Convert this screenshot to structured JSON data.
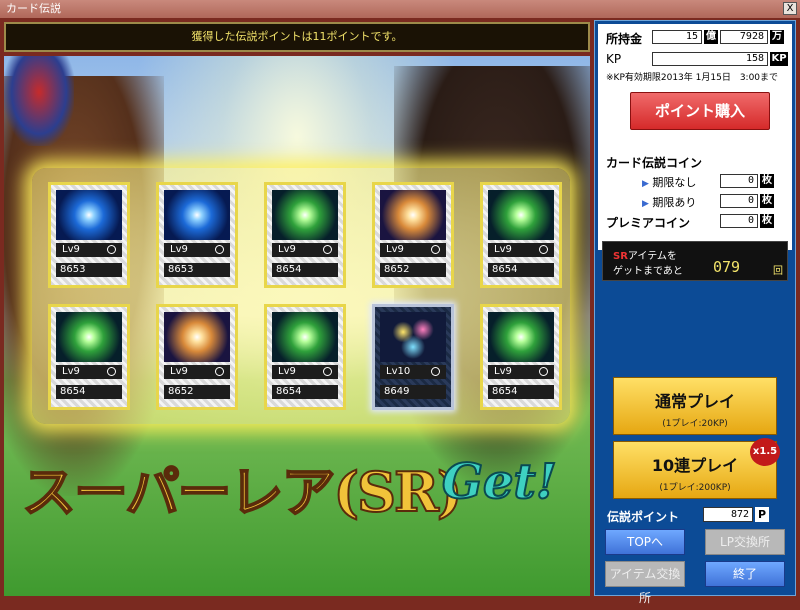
{
  "window": {
    "title": "カード伝説",
    "close_label": "X"
  },
  "message": "獲得した伝説ポイントは11ポイントです。",
  "cards": [
    {
      "level": "Lv9",
      "mark": "○",
      "number": "8653",
      "art": "blue"
    },
    {
      "level": "Lv9",
      "mark": "○",
      "number": "8653",
      "art": "blue"
    },
    {
      "level": "Lv9",
      "mark": "○",
      "number": "8654",
      "art": "green"
    },
    {
      "level": "Lv9",
      "mark": "○",
      "number": "8652",
      "art": "orange"
    },
    {
      "level": "Lv9",
      "mark": "○",
      "number": "8654",
      "art": "green"
    },
    {
      "level": "Lv9",
      "mark": "○",
      "number": "8654",
      "art": "green"
    },
    {
      "level": "Lv9",
      "mark": "○",
      "number": "8652",
      "art": "orange"
    },
    {
      "level": "Lv9",
      "mark": "○",
      "number": "8654",
      "art": "green"
    },
    {
      "level": "Lv10",
      "mark": "○",
      "number": "8649",
      "art": "firework"
    },
    {
      "level": "Lv9",
      "mark": "○",
      "number": "8654",
      "art": "green"
    }
  ],
  "banner": {
    "text_jp": "スーパーレア(SR)",
    "text_get": "Get!"
  },
  "panel": {
    "money_label": "所持金",
    "money_oku": "15",
    "oku_unit": "億",
    "money_man": "7928",
    "man_unit": "万",
    "kp_label": "KP",
    "kp_value": "158",
    "kp_unit": "KP",
    "kp_expiry": "※KP有効期限2013年 1月15日　3:00まで",
    "buy_button": "ポイント購入",
    "coin_title": "カード伝説コイン",
    "coin_no_limit_label": "期限なし",
    "coin_no_limit_value": "0",
    "coin_limit_label": "期限あり",
    "coin_limit_value": "0",
    "premia_label": "プレミアコイン",
    "premia_value": "0",
    "coin_unit": "枚",
    "sr_line1_sr": "SR",
    "sr_line1_rest": "アイテムを",
    "sr_line2": "ゲットまであと",
    "sr_remaining": "079",
    "sr_unit": "回",
    "play_normal": "通常プレイ",
    "play_normal_sub": "(1プレイ:20KP)",
    "play_10": "10連プレイ",
    "play_10_sub": "(1プレイ:200KP)",
    "play_10_badge": "x1.5",
    "lp_label": "伝説ポイント",
    "lp_value": "872",
    "lp_unit": "P",
    "top_button": "TOPへ",
    "lp_exchange_button": "LP交換所",
    "item_exchange_button": "アイテム交換所",
    "exit_button": "終了"
  }
}
